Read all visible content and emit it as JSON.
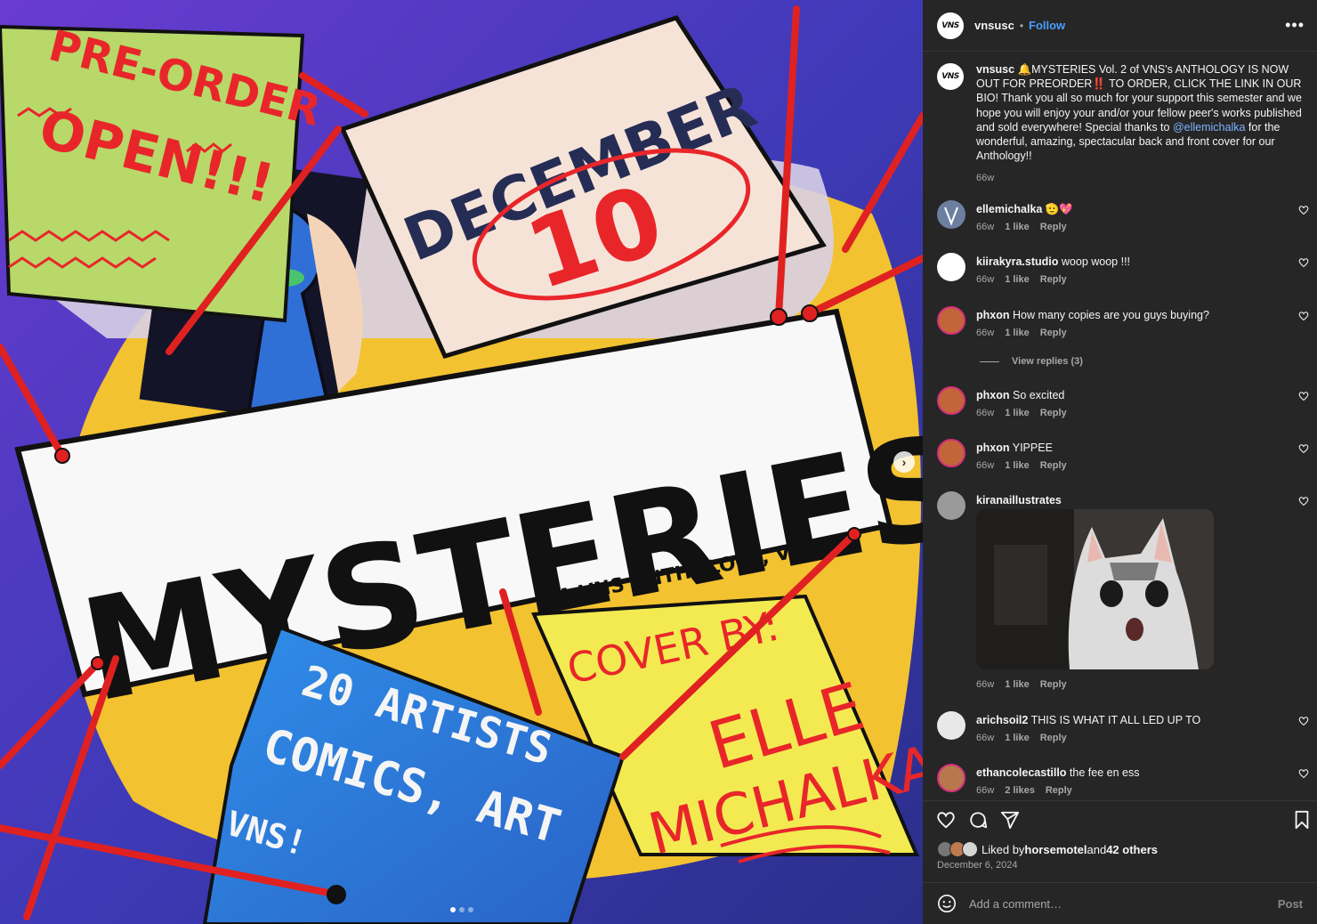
{
  "post_image": {
    "sign_preorder_line1": "PRE-ORDER",
    "sign_preorder_line2": "OPEN!!!",
    "calendar_month": "DECEMBER",
    "calendar_day": "10",
    "title": "MYSTERIES",
    "subtitle": "A VNS ANTHOLOGY, VOL 2.",
    "sign_blue_line1": "20 ARTISTS",
    "sign_blue_line2": "COMICS, ART",
    "sign_blue_line3": "VNS!",
    "cover_by_label": "COVER BY:",
    "cover_artist_line1": "ELLE",
    "cover_artist_line2": "MICHALKA",
    "next_icon": "chevron-right-icon",
    "carousel": {
      "count": 3,
      "active": 0
    }
  },
  "header": {
    "avatar_text": "VNS",
    "username": "vnsusc",
    "separator": "•",
    "follow_label": "Follow",
    "more_icon": "•••"
  },
  "caption": {
    "username": "vnsusc",
    "text_part1": "🔔MYSTERIES Vol. 2 of VNS's ANTHOLOGY IS NOW OUT FOR PREORDER‼️ TO ORDER, CLICK THE LINK IN OUR BIO! Thank you all so much for your support this semester and we hope you will enjoy your and/or your fellow peer's works published and sold everywhere! Special thanks to ",
    "mention": "@ellemichalka",
    "text_part2": " for the wonderful, amazing, spectacular back and front cover for our Anthology!!",
    "time": "66w"
  },
  "comments": [
    {
      "username": "ellemichalka",
      "text": "🫡💖",
      "time": "66w",
      "likes": "1 like",
      "reply": "Reply",
      "avatar_color": "#6d7fa0"
    },
    {
      "username": "kiirakyra.studio",
      "text": "woop woop !!!",
      "time": "66w",
      "likes": "1 like",
      "reply": "Reply",
      "avatar_color": "#ffffff"
    },
    {
      "username": "phxon",
      "text": "How many copies are you guys buying?",
      "time": "66w",
      "likes": "1 like",
      "reply": "Reply",
      "avatar_color": "#c2663a"
    },
    {
      "username": "phxon",
      "text": "So excited",
      "time": "66w",
      "likes": "1 like",
      "reply": "Reply",
      "avatar_color": "#c2663a"
    },
    {
      "username": "phxon",
      "text": "YIPPEE",
      "time": "66w",
      "likes": "1 like",
      "reply": "Reply",
      "avatar_color": "#c2663a"
    },
    {
      "username": "kiranaillustrates",
      "text": "",
      "time": "66w",
      "likes": "1 like",
      "reply": "Reply",
      "avatar_color": "#9a9a9a"
    },
    {
      "username": "arichsoil2",
      "text": "THIS IS WHAT IT ALL LED UP TO",
      "time": "66w",
      "likes": "1 like",
      "reply": "Reply",
      "avatar_color": "#e8e8e8"
    },
    {
      "username": "ethancolecastillo",
      "text": "the fee en ess",
      "time": "66w",
      "likes": "2 likes",
      "reply": "Reply",
      "avatar_color": "#b7784e"
    }
  ],
  "view_replies": "View replies (3)",
  "actions": {
    "like_icon": "heart-icon",
    "comment_icon": "comment-icon",
    "share_icon": "share-icon",
    "save_icon": "bookmark-icon"
  },
  "likes": {
    "prefix": "Liked by ",
    "user": "horsemotel",
    "middle": " and ",
    "others": "42 others"
  },
  "post_date": "December 6, 2024",
  "add_comment": {
    "placeholder": "Add a comment…",
    "post_label": "Post",
    "emoji_icon": "emoji-icon"
  },
  "colors": {
    "panel_bg": "#262626",
    "link_blue": "#4a9eff",
    "muted": "#a8a8a8"
  }
}
